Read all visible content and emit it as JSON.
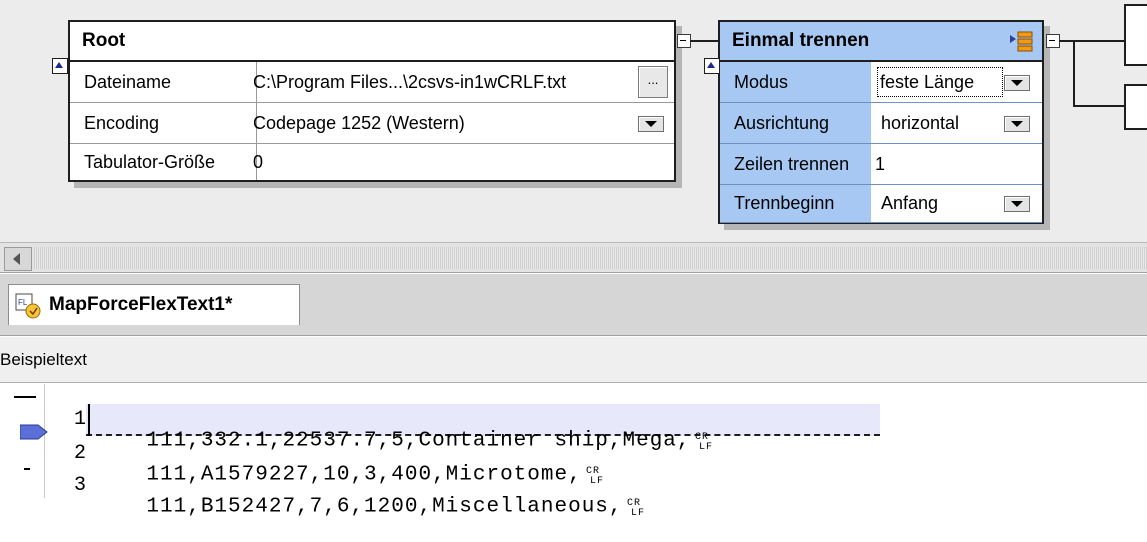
{
  "root": {
    "title": "Root",
    "rows": [
      {
        "label": "Dateiname",
        "value": "C:\\Program Files...\\2csvs-in1wCRLF.txt",
        "button": "..."
      },
      {
        "label": "Encoding",
        "value": "Codepage 1252 (Western)"
      },
      {
        "label": "Tabulator-Größe",
        "value": "0"
      }
    ]
  },
  "split": {
    "title": "Einmal trennen",
    "rows": [
      {
        "label": "Modus",
        "value": "feste Länge"
      },
      {
        "label": "Ausrichtung",
        "value": "horizontal"
      },
      {
        "label": "Zeilen trennen",
        "value": "1"
      },
      {
        "label": "Trennbeginn",
        "value": "Anfang"
      }
    ]
  },
  "tab": {
    "label": "MapForceFlexText1*"
  },
  "sample_label": "Beispieltext",
  "lines": [
    {
      "num": "1",
      "text": "111,332.1,22537.7,5,Container ship,Mega,"
    },
    {
      "num": "2",
      "text": "111,A1579227,10,3,400,Microtome,"
    },
    {
      "num": "3",
      "text": "111,B152427,7,6,1200,Miscellaneous,"
    }
  ],
  "colors": {
    "component_blue": "#a6c8f2",
    "line_highlight": "#e8e8fb",
    "marker_blue": "#5b6fd8"
  },
  "icons": {
    "split_icon": "orange-split-icon",
    "crlf": "crlf-marker-icon",
    "tab_icon": "flextext-file-icon"
  }
}
